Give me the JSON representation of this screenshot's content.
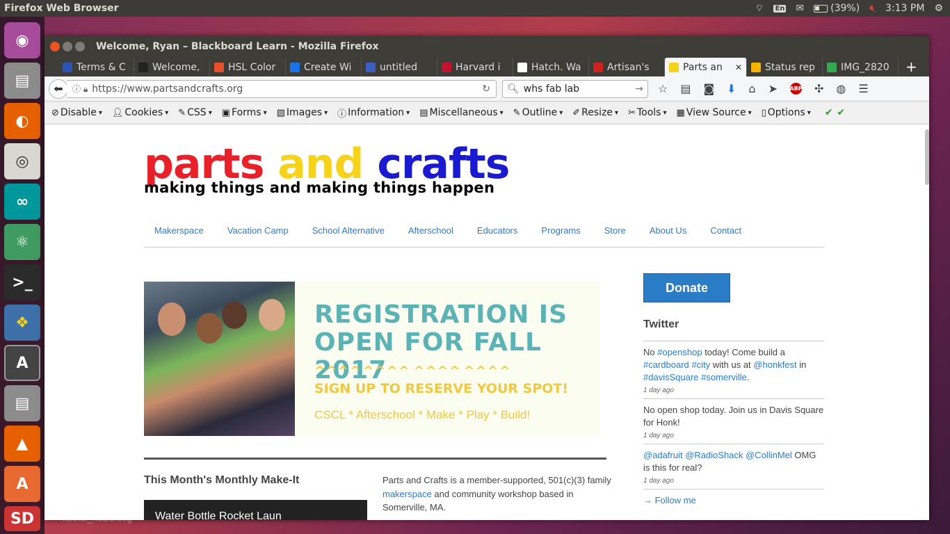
{
  "top_panel": {
    "app_title": "Firefox Web Browser",
    "keyboard": "En",
    "battery": "(39%)",
    "time": "3:13 PM"
  },
  "window": {
    "title": "Welcome, Ryan – Blackboard Learn - Mozilla Firefox"
  },
  "tabs": [
    {
      "label": "Terms & C",
      "color": "#2a55b5"
    },
    {
      "label": "Welcome,",
      "color": "#222222"
    },
    {
      "label": "HSL Color",
      "color": "#e8502a"
    },
    {
      "label": "Create Wi",
      "color": "#1a73e8"
    },
    {
      "label": "untitled",
      "color": "#3b5fc0"
    },
    {
      "label": "Harvard i",
      "color": "#c4122f"
    },
    {
      "label": "Hatch. Wa",
      "color": "#ffffff"
    },
    {
      "label": "Artisan's",
      "color": "#d02020"
    },
    {
      "label": "Parts an",
      "color": "#f7d21b"
    },
    {
      "label": "Status rep",
      "color": "#f4b400"
    },
    {
      "label": "IMG_2820",
      "color": "#34a853"
    }
  ],
  "active_tab_index": 8,
  "navbar": {
    "url": "https://www.partsandcrafts.org",
    "search": "whs fab lab"
  },
  "devbar": {
    "items": [
      "Disable",
      "Cookies",
      "CSS",
      "Forms",
      "Images",
      "Information",
      "Miscellaneous",
      "Outline",
      "Resize",
      "Tools",
      "View Source",
      "Options"
    ]
  },
  "site": {
    "logo_parts": "parts",
    "logo_and": "and",
    "logo_crafts": "crafts",
    "tagline": "making things and making things happen",
    "nav": [
      "Makerspace",
      "Vacation Camp",
      "School Alternative",
      "Afterschool",
      "Educators",
      "Programs",
      "Store",
      "About Us",
      "Contact"
    ],
    "banner": {
      "heading_line1": "REGISTRATION IS",
      "heading_line2": "OPEN FOR FALL 2017",
      "signup": "SIGN UP TO RESERVE YOUR SPOT!",
      "programs": "CSCL * Afterschool * Make * Play * Build!"
    },
    "makeit_title": "This Month's Monthly Make-It",
    "video_title": "Water Bottle Rocket Laun",
    "about_text_before": "Parts and Crafts is a member-supported, 501(c)(3) family ",
    "about_link": "makerspace",
    "about_text_after": " and community workshop based in Somerville, MA.",
    "donate": "Donate",
    "twitter_title": "Twitter",
    "follow": "→ Follow me"
  },
  "desktop_file": "funnel_noBG.svg"
}
